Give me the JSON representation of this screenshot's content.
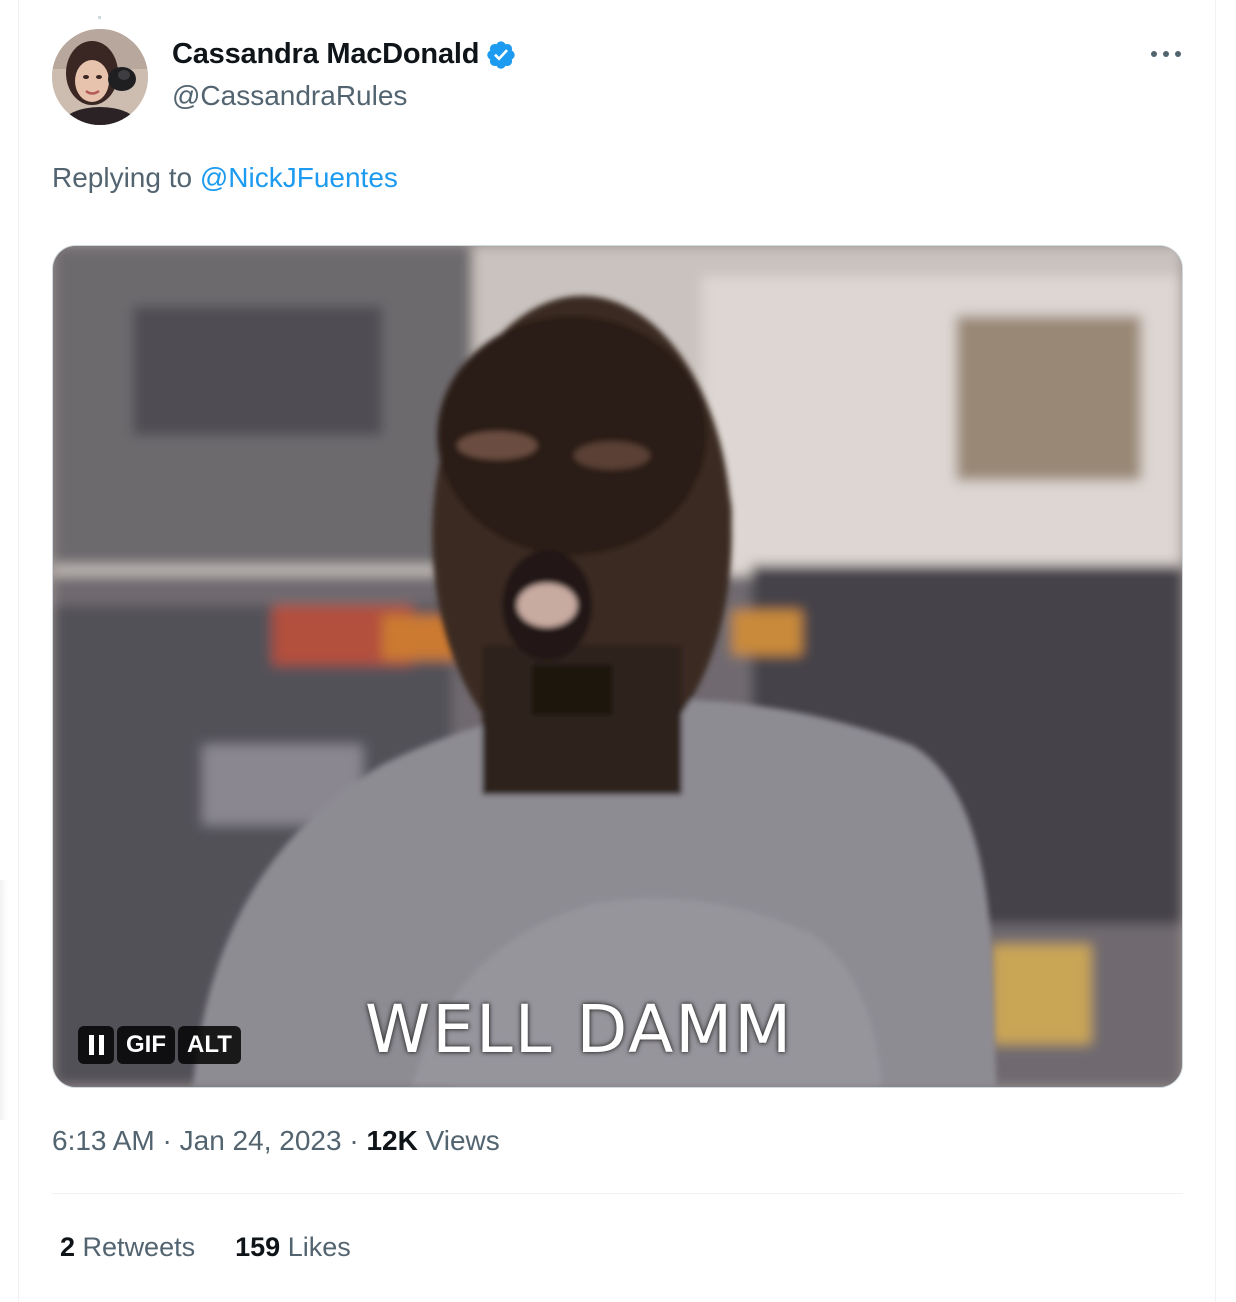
{
  "tweet": {
    "display_name": "Cassandra MacDonald",
    "handle": "@CassandraRules",
    "verified_icon": "verified-badge-icon",
    "more_icon": "more-options-icon",
    "reply_prefix": "Replying to",
    "reply_to": "@NickJFuentes",
    "media": {
      "caption": "WELL DAMM",
      "controls": {
        "pause_icon": "pause-icon",
        "gif_label": "GIF",
        "alt_label": "ALT"
      }
    },
    "time": "6:13 AM",
    "date": "Jan 24, 2023",
    "separator": "·",
    "views_count": "12K",
    "views_label": "Views",
    "retweets_count": "2",
    "retweets_label": "Retweets",
    "likes_count": "159",
    "likes_label": "Likes"
  },
  "colors": {
    "accent": "#1d9bf0",
    "primary_text": "#0f1419",
    "secondary_text": "#536471",
    "border": "#eff3f4"
  }
}
